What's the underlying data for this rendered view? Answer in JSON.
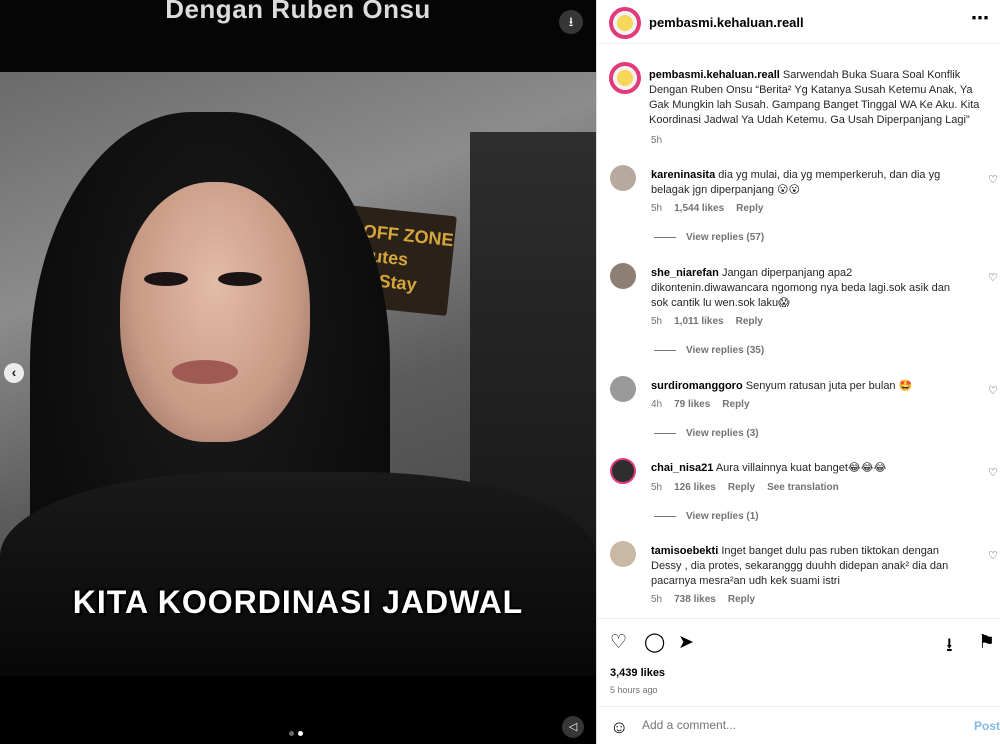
{
  "media": {
    "top_caption": "Dengan Ruben Onsu",
    "subtitle_1": "KITA KOORDINASI JADWAL",
    "sign_text": "OFF ZONE\nnutes\nm Stay"
  },
  "post": {
    "username": "pembasmi.kehaluan.reall",
    "caption_text": "Sarwendah Buka Suara Soal Konflik Dengan Ruben Onsu “Berita² Yg Katanya Susah Ketemu Anak, Ya Gak Mungkin lah Susah. Gampang Banget Tinggal WA Ke Aku. Kita Koordinasi Jadwal Ya Udah Ketemu. Ga Usah Diperpanjang Lagi”",
    "caption_time": "5h",
    "likes": "3,439 likes",
    "posted_ago": "5 hours ago"
  },
  "comments": [
    {
      "user": "kareninasita",
      "text": "dia yg mulai, dia yg memperkeruh, dan dia yg belagak jgn diperpanjang 😮😮",
      "time": "5h",
      "likes": "1,544 likes",
      "reply": "Reply",
      "view_replies": "View replies (57)"
    },
    {
      "user": "she_niarefan",
      "text": "Jangan diperpanjang apa2 dikontenin.diwawancara ngomong nya beda lagi.sok asik dan sok cantik lu wen.sok laku😱",
      "time": "5h",
      "likes": "1,011 likes",
      "reply": "Reply",
      "view_replies": "View replies (35)"
    },
    {
      "user": "surdiromanggoro",
      "text": "Senyum ratusan juta per bulan 🤩",
      "time": "4h",
      "likes": "79 likes",
      "reply": "Reply",
      "view_replies": "View replies (3)"
    },
    {
      "user": "chai_nisa21",
      "text": "Aura villainnya kuat banget😂😂😂",
      "time": "5h",
      "likes": "126 likes",
      "reply": "Reply",
      "see_translation": "See translation",
      "view_replies": "View replies (1)"
    },
    {
      "user": "tamisoebekti",
      "text": "Inget banget dulu pas ruben tiktokan dengan Dessy , dia protes, sekaranggg duuhh didepan anak² dia dan pacarnya mesra²an udh kek suami istri",
      "time": "5h",
      "likes": "738 likes",
      "reply": "Reply"
    }
  ],
  "composer": {
    "placeholder": "Add a comment...",
    "post_label": "Post"
  },
  "icons": {
    "more": "⋯",
    "heart": "♡",
    "comment": "◯",
    "share": "➤",
    "save": "⚑",
    "download": "⭳",
    "emoji": "☺",
    "prev": "‹",
    "mute": "◁"
  }
}
